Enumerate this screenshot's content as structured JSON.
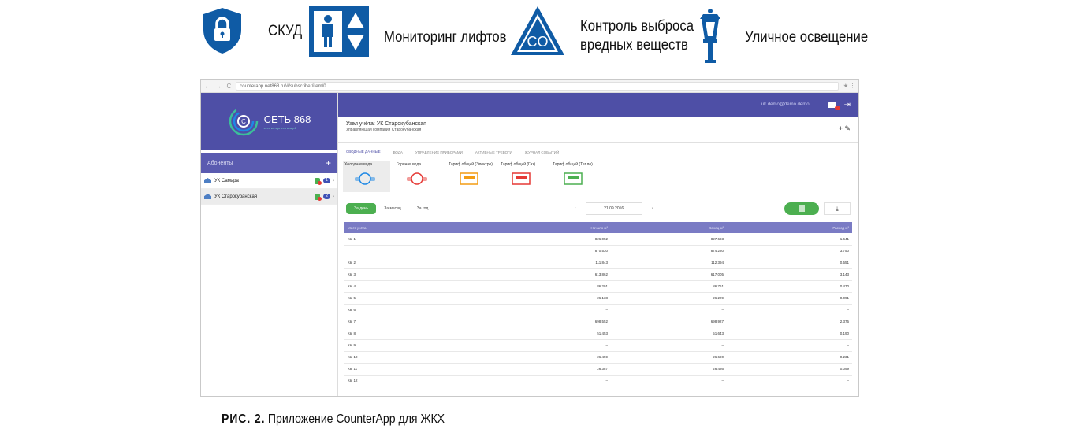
{
  "features": [
    {
      "icon": "lock-shield-icon",
      "label": "СКУД"
    },
    {
      "icon": "elevator-icon",
      "label": "Мониторинг лифтов"
    },
    {
      "icon": "co-warning-icon",
      "label_line1": "Контроль выброса",
      "label_line2": "вредных веществ"
    },
    {
      "icon": "street-lamp-icon",
      "label": "Уличное освещение"
    }
  ],
  "co_text": "CO",
  "colors": {
    "accent": "#0f5ba5",
    "primary": "#4e4fa6",
    "green": "#4caf50"
  },
  "browser": {
    "url": "counterapp.net868.ru/#/subscriber/item/0",
    "nav": "← → C"
  },
  "sidebar": {
    "brand": "СЕТЬ 868",
    "brand_sub": "сеть интернета вещей",
    "header": "Абоненты",
    "add": "+",
    "items": [
      {
        "label": "УК Самара",
        "count": "1"
      },
      {
        "label": "УК Старокубанская",
        "count": "2"
      }
    ]
  },
  "topbar": {
    "user": "uk.demo@demo.demo"
  },
  "node": {
    "title": "Узел учёта: УК Старокубанская",
    "subtitle": "Управляющая компания Старокубанская",
    "actions": "+ ✎"
  },
  "tabs": [
    "Сводные данные",
    "Вода",
    "Управление приборами",
    "Активные тревоги",
    "Журнал событий"
  ],
  "meters": [
    {
      "label": "Холодная вода"
    },
    {
      "label": "Горячая вода"
    },
    {
      "label": "Тариф общий (Электро)"
    },
    {
      "label": "Тариф общий (Газ)"
    },
    {
      "label": "Тариф общий (Тепло)"
    }
  ],
  "periods": [
    "За день",
    "За месяц",
    "За год"
  ],
  "date": "21.09.2016",
  "table": {
    "headers": [
      "Мест учёта",
      "Начало м³",
      "Конец м³",
      "Расход м³"
    ],
    "rows": [
      [
        "Кв. 1",
        "826.052",
        "827.693",
        "1.641"
      ],
      [
        "",
        "870.530",
        "874.280",
        "3.750"
      ],
      [
        "Кв. 2",
        "111.843",
        "112.394",
        "0.551"
      ],
      [
        "Кв. 3",
        "613.862",
        "617.005",
        "3.143"
      ],
      [
        "Кв. 4",
        "86.291",
        "86.761",
        "0.470"
      ],
      [
        "Кв. 5",
        "26.138",
        "26.229",
        "0.091"
      ],
      [
        "Кв. 6",
        "–",
        "–",
        "–"
      ],
      [
        "Кв. 7",
        "698.552",
        "698.927",
        "2.375"
      ],
      [
        "Кв. 8",
        "51.453",
        "51.643",
        "0.190"
      ],
      [
        "Кв. 9",
        "–",
        "–",
        "–"
      ],
      [
        "Кв. 10",
        "26.459",
        "26.690",
        "0.231"
      ],
      [
        "Кв. 11",
        "26.387",
        "26.486",
        "0.099"
      ],
      [
        "Кв. 12",
        "–",
        "–",
        "–"
      ]
    ]
  },
  "caption": {
    "prefix": "РИС. 2.",
    "text": "Приложение CounterApp для ЖКХ"
  }
}
